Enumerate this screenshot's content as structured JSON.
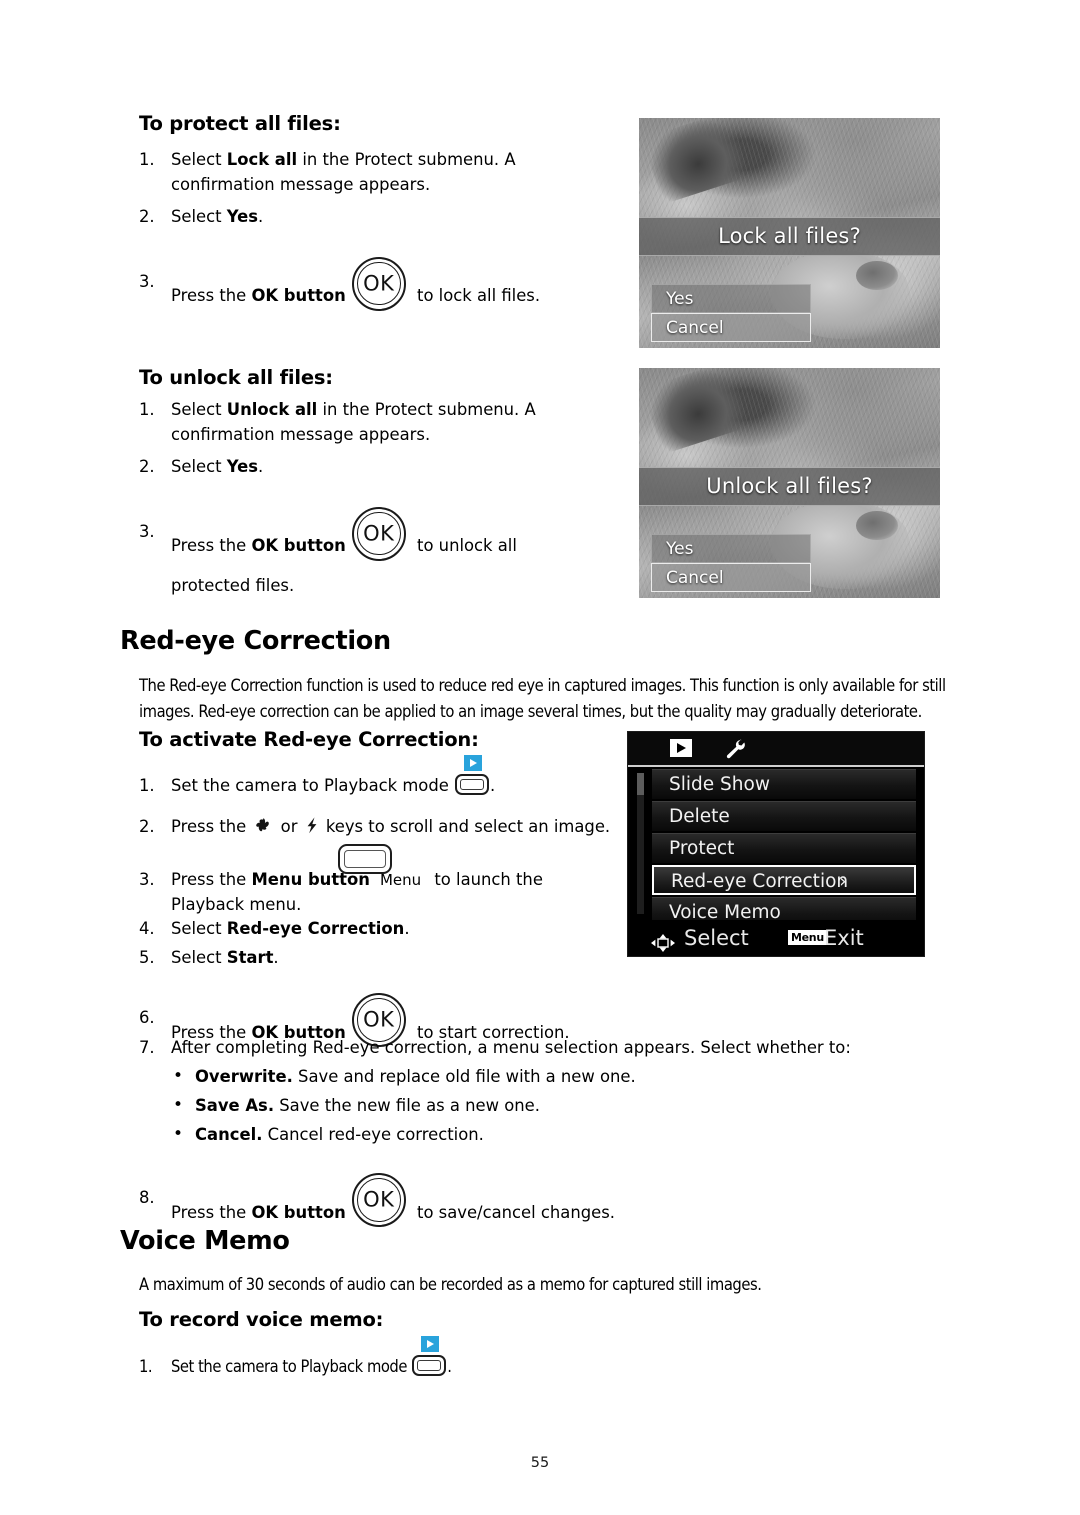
{
  "page": {
    "number": "55"
  },
  "section_protect": {
    "heading": "To protect all files:",
    "steps": [
      {
        "num": "1.",
        "pre": "Select ",
        "bold": "Lock all",
        "post": " in the Protect submenu. A confirmation message appears."
      },
      {
        "num": "2.",
        "pre": "Select ",
        "bold": "Yes",
        "post": "."
      },
      {
        "num": "3.",
        "pre": "Press the ",
        "bold": "OK button",
        "post": " to lock all files.",
        "icon": "ok-button-icon",
        "icon_label": "OK"
      }
    ]
  },
  "section_unlock": {
    "heading": "To unlock all files:",
    "steps": [
      {
        "num": "1.",
        "pre": "Select ",
        "bold": "Unlock all",
        "post": " in the Protect submenu. A confirmation message appears."
      },
      {
        "num": "2.",
        "pre": "Select ",
        "bold": "Yes",
        "post": "."
      },
      {
        "num": "3.",
        "pre": "Press the ",
        "bold": "OK button",
        "post": " to unlock all protected files.",
        "icon": "ok-button-icon",
        "icon_label": "OK"
      }
    ]
  },
  "screenshot_lock": {
    "title": "Lock all files?",
    "options": [
      {
        "label": "Yes",
        "selected": false
      },
      {
        "label": "Cancel",
        "selected": true
      }
    ]
  },
  "screenshot_unlock": {
    "title": "Unlock all files?",
    "options": [
      {
        "label": "Yes",
        "selected": false
      },
      {
        "label": "Cancel",
        "selected": true
      }
    ]
  },
  "section_redeye": {
    "heading": "Red-eye Correction",
    "intro": "The Red-eye Correction function is used to reduce red eye in captured images. This function is only available for still images. Red-eye correction can be applied to an image several times, but the quality may gradually deteriorate.",
    "sub_heading": "To activate Red-eye Correction:",
    "steps": [
      {
        "num": "1.",
        "text_before": "Set the camera to Playback mode ",
        "icon": "playback-mode-icon",
        "text_after": "."
      },
      {
        "num": "2.",
        "text_before": "Press the ",
        "icon1": "macro-tulip-icon",
        "mid": " or ",
        "icon2": "flash-bolt-icon",
        "text_after": " keys to scroll and select an image."
      },
      {
        "num": "3.",
        "pre": "Press the ",
        "bold": "Menu button",
        "icon": "menu-hard-button-icon",
        "icon_label": "Menu",
        "post": " to launch the Playback menu."
      },
      {
        "num": "4.",
        "pre": "Select ",
        "bold": "Red-eye Correction",
        "post": "."
      },
      {
        "num": "5.",
        "pre": "Select ",
        "bold": "Start",
        "post": "."
      },
      {
        "num": "6.",
        "pre": "Press the ",
        "bold": "OK button",
        "post": " to start correction.",
        "icon": "ok-button-icon",
        "icon_label": "OK"
      },
      {
        "num": "7.",
        "plain": "After completing Red-eye correction, a menu selection appears. Select whether to:"
      }
    ],
    "bullets": [
      {
        "bold": "Overwrite.",
        "rest": " Save and replace old file with a new one."
      },
      {
        "bold": "Save As.",
        "rest": " Save the new file as a new one."
      },
      {
        "bold": "Cancel.",
        "rest": " Cancel red-eye correction."
      }
    ],
    "final_step": {
      "num": "8.",
      "pre": "Press the ",
      "bold": "OK button",
      "post": " to save/cancel changes.",
      "icon": "ok-button-icon",
      "icon_label": "OK"
    }
  },
  "screenshot_menu": {
    "tabs": [
      {
        "name": "playback-tab-icon"
      },
      {
        "name": "setup-wrench-tab-icon"
      }
    ],
    "items": [
      {
        "label": "Slide Show",
        "selected": false,
        "arrow": ""
      },
      {
        "label": "Delete",
        "selected": false,
        "arrow": ""
      },
      {
        "label": "Protect",
        "selected": false,
        "arrow": ""
      },
      {
        "label": "Red-eye Correction",
        "selected": true,
        "arrow": "›"
      },
      {
        "label": "Voice Memo",
        "selected": false,
        "arrow": ""
      }
    ],
    "footer": {
      "select_label": "Select",
      "menu_badge": "Menu",
      "exit_label": "Exit"
    }
  },
  "section_voicememo": {
    "heading": "Voice Memo",
    "intro": "A maximum of 30 seconds of audio can be recorded as a memo for captured still images.",
    "sub_heading": "To record voice memo:",
    "steps": [
      {
        "num": "1.",
        "text_before": "Set the camera to Playback mode ",
        "icon": "playback-mode-icon",
        "text_after": "."
      }
    ]
  }
}
